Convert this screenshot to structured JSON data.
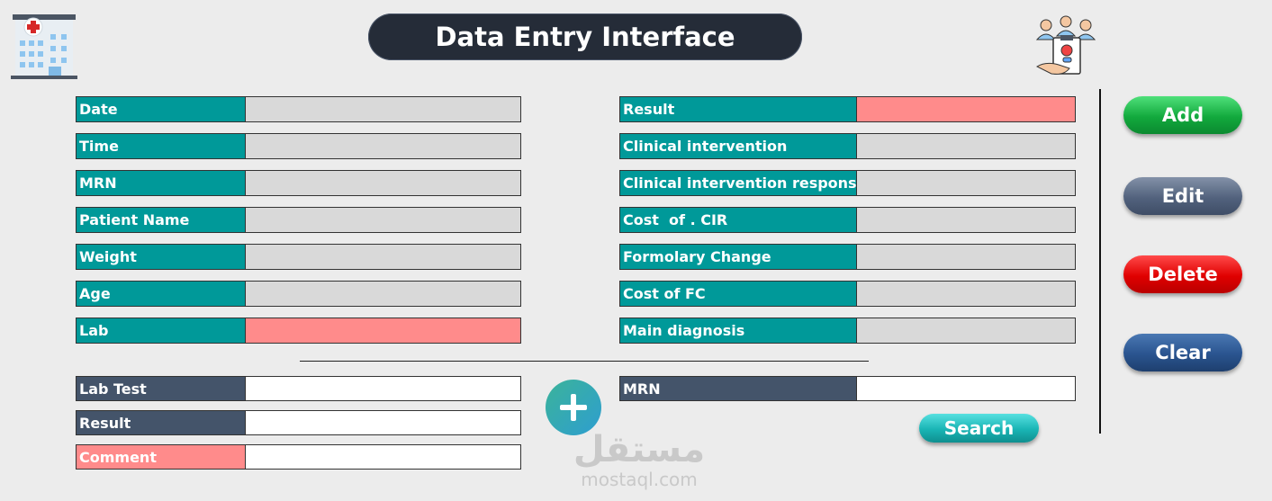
{
  "title": "Data Entry Interface",
  "icons": {
    "hospital": "hospital-icon",
    "patients": "patient-care-icon",
    "plus": "plus-icon"
  },
  "colors": {
    "label_teal": "#009999",
    "label_slate": "#44546a",
    "highlight_pink": "#ff8b8b",
    "field_gray": "#d9d9d9"
  },
  "left_fields": [
    {
      "label": "Date",
      "value": ""
    },
    {
      "label": "Time",
      "value": ""
    },
    {
      "label": "MRN",
      "value": ""
    },
    {
      "label": "Patient Name",
      "value": ""
    },
    {
      "label": "Weight",
      "value": ""
    },
    {
      "label": "Age",
      "value": ""
    },
    {
      "label": "Lab",
      "value": ""
    }
  ],
  "right_fields": [
    {
      "label": "Result",
      "value": ""
    },
    {
      "label": "Clinical intervention",
      "value": ""
    },
    {
      "label": "Clinical intervention response",
      "value": ""
    },
    {
      "label": "Cost  of . CIR",
      "value": ""
    },
    {
      "label": "Formolary Change",
      "value": ""
    },
    {
      "label": "Cost of FC",
      "value": ""
    },
    {
      "label": "Main diagnosis",
      "value": ""
    }
  ],
  "lab_fields": [
    {
      "label": "Lab Test",
      "value": ""
    },
    {
      "label": "Result",
      "value": ""
    },
    {
      "label": "Comment",
      "value": ""
    }
  ],
  "search": {
    "label": "MRN",
    "value": "",
    "button": "Search"
  },
  "buttons": {
    "add": "Add",
    "edit": "Edit",
    "delete": "Delete",
    "clear": "Clear"
  },
  "watermark": {
    "arabic": "مستقل",
    "latin": "mostaql.com"
  }
}
